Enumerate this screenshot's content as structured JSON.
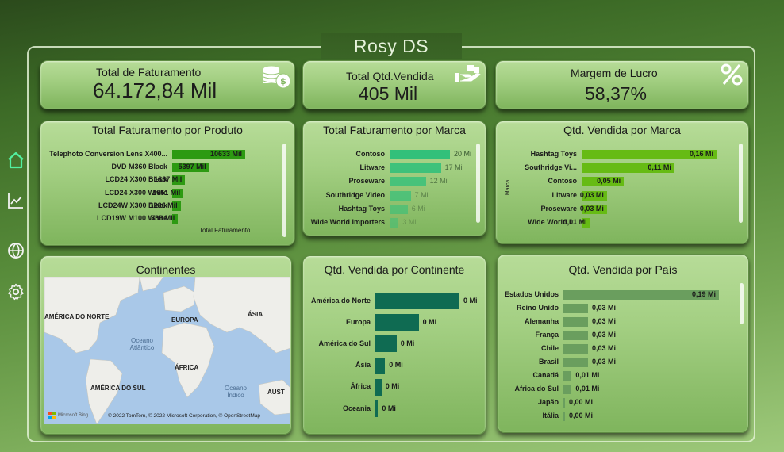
{
  "title": "Rosy DS",
  "nav": [
    {
      "icon": "home-icon"
    },
    {
      "icon": "trend-chart-icon"
    },
    {
      "icon": "globe-icon"
    },
    {
      "icon": "settings-gear-icon"
    }
  ],
  "kpis": {
    "faturamento": {
      "title": "Total de Faturamento",
      "value": "64.172,84 Mil",
      "icon": "coins-dollar-icon"
    },
    "qtd": {
      "title": "Total Qtd.Vendida",
      "value": "405 Mil",
      "icon": "hand-box-icon"
    },
    "margem": {
      "title": "Margem de Lucro",
      "value": "58,37%",
      "icon": "percent-icon"
    }
  },
  "colors": {
    "produto_bar": "#2d9a12",
    "marca_bar": "#33c07a",
    "qtd_marca_bar": "#66bb14",
    "continente_bar": "#0f6b52",
    "pais_bar": "#6a9e5e"
  },
  "cards": {
    "produto_title": "Total Faturamento por Produto",
    "produto_axis": "Total Faturamento",
    "marca_title": "Total Faturamento por Marca",
    "qtd_marca_title": "Qtd. Vendida por Marca",
    "qtd_marca_axis": "Marca",
    "continentes_title": "Continentes",
    "qtd_cont_title": "Qtd. Vendida por Continente",
    "qtd_pais_title": "Qtd. Vendida por País"
  },
  "map": {
    "labels": [
      "AMÉRICA DO NORTE",
      "EUROPA",
      "ÁSIA",
      "ÁFRICA",
      "AMÉRICA DO SUL",
      "AUST"
    ],
    "oceans": [
      "Oceano Atlântico",
      "Oceano Índico"
    ],
    "brand": "Microsoft Bing",
    "copyright": "© 2022 TomTom, © 2022 Microsoft Corporation, © OpenStreetMap"
  },
  "chart_data": [
    {
      "type": "bar",
      "title": "Total Faturamento por Produto",
      "categories": [
        "Telephoto Conversion Lens X400...",
        "DVD M360 Black",
        "LCD24 X300 Black",
        "LCD24 X300 White",
        "LCD24W X300 Black",
        "LCD19W M100 White"
      ],
      "values": [
        10633,
        5397,
        1887,
        1651,
        1236,
        836
      ],
      "labels": [
        "10633 Mil",
        "5397 Mil",
        "1887 Mil",
        "1651 Mil",
        "1236 Mil",
        "836 Mil"
      ],
      "xlabel": "Total Faturamento"
    },
    {
      "type": "bar",
      "title": "Total Faturamento por Marca",
      "categories": [
        "Contoso",
        "Litware",
        "Proseware",
        "Southridge Video",
        "Hashtag Toys",
        "Wide World Importers"
      ],
      "values": [
        20,
        17,
        12,
        7,
        6,
        3
      ],
      "labels": [
        "20 Mi",
        "17 Mi",
        "12 Mi",
        "7 Mi",
        "6 Mi",
        "3 Mi"
      ]
    },
    {
      "type": "bar",
      "title": "Qtd. Vendida por Marca",
      "categories": [
        "Hashtag Toys",
        "Southridge Vi...",
        "Contoso",
        "Litware",
        "Proseware",
        "Wide World I..."
      ],
      "values": [
        0.16,
        0.11,
        0.05,
        0.03,
        0.03,
        0.01
      ],
      "labels": [
        "0,16 Mi",
        "0,11 Mi",
        "0,05 Mi",
        "0,03 Mi",
        "0,03 Mi",
        "0,01 Mi"
      ],
      "ylabel": "Marca"
    },
    {
      "type": "bar",
      "title": "Qtd. Vendida por Continente",
      "categories": [
        "América do Norte",
        "Europa",
        "América do Sul",
        "Ásia",
        "África",
        "Oceania"
      ],
      "values": [
        0.19,
        0.098,
        0.048,
        0.022,
        0.014,
        0.006
      ],
      "labels": [
        "0 Mi",
        "0 Mi",
        "0 Mi",
        "0 Mi",
        "0 Mi",
        "0 Mi"
      ]
    },
    {
      "type": "bar",
      "title": "Qtd. Vendida por País",
      "categories": [
        "Estados Unidos",
        "Reino Unido",
        "Alemanha",
        "França",
        "Chile",
        "Brasil",
        "Canadá",
        "África do Sul",
        "Japão",
        "Itália"
      ],
      "values": [
        0.19,
        0.03,
        0.03,
        0.03,
        0.03,
        0.03,
        0.01,
        0.01,
        0.0,
        0.0
      ],
      "labels": [
        "0,19 Mi",
        "0,03 Mi",
        "0,03 Mi",
        "0,03 Mi",
        "0,03 Mi",
        "0,03 Mi",
        "0,01 Mi",
        "0,01 Mi",
        "0,00 Mi",
        "0,00 Mi"
      ]
    }
  ]
}
